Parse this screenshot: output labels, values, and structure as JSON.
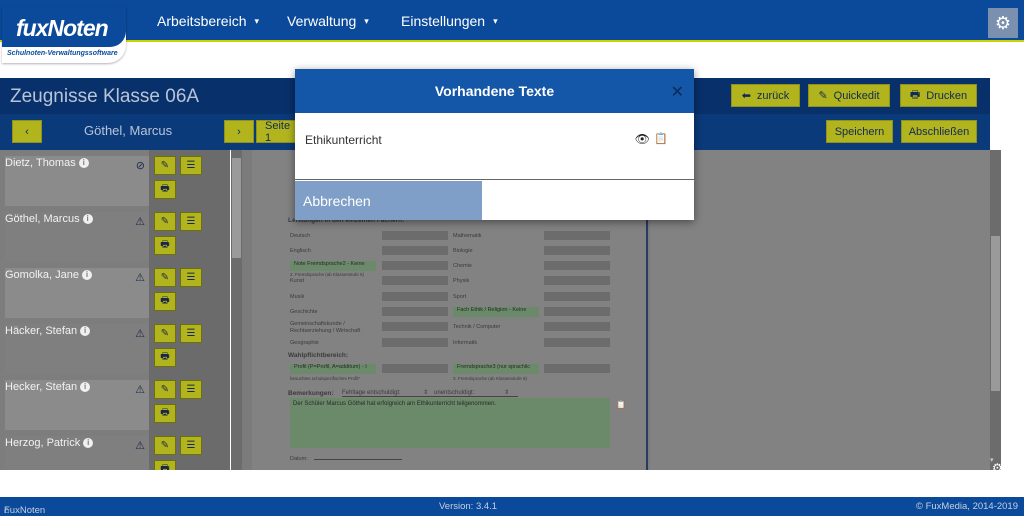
{
  "app": {
    "brand_part1": "fux",
    "brand_part2": "Noten",
    "tagline": "Schulnoten-Verwaltungssoftware"
  },
  "nav": {
    "items": [
      {
        "label": "Arbeitsbereich"
      },
      {
        "label": "Verwaltung"
      },
      {
        "label": "Einstellungen"
      }
    ],
    "caret": "▾",
    "settings_icon": "gear-icon"
  },
  "page": {
    "title": "Zeugnisse Klasse 06A",
    "current_student": "Göthel, Marcus",
    "page_label": "Seite 1",
    "buttons": {
      "back": "zurück",
      "quickedit": "Quickedit",
      "print": "Drucken",
      "save": "Speichern",
      "finish": "Abschließen"
    }
  },
  "students": [
    {
      "name": "Dietz, Thomas",
      "status": "check"
    },
    {
      "name": "Göthel, Marcus",
      "status": "warning"
    },
    {
      "name": "Gomolka, Jane",
      "status": "warning"
    },
    {
      "name": "Häcker, Stefan",
      "status": "warning"
    },
    {
      "name": "Hecker, Stefan",
      "status": "warning"
    },
    {
      "name": "Herzog, Patrick",
      "status": "warning"
    }
  ],
  "document": {
    "section_subjects": "Leistungen in den einzelnen Fächern:",
    "subjects_left": [
      "Deutsch",
      "Englisch",
      "Note Fremdsprache2 - Keine",
      "2. Fremdsprache (ab Klassenstufe 6)",
      "Kunst",
      "Musik",
      "Geschichte",
      "Gemeinschaftskunde / Rechtserziehung / Wirtschaft",
      "Geographie"
    ],
    "subjects_right": [
      "Mathematik",
      "Biologie",
      "Chemie",
      "Physik",
      "Sport",
      "Fach Ethik / Religion - Keine",
      "Technik / Computer",
      "Informatik"
    ],
    "section_elective": "Wahlpflichtbereich:",
    "elective_left": "Profil (P=Profil, A=additum) - I",
    "elective_left_note": "besuchtes schulspezifisches Profil*",
    "elective_right": "Fremdsprache3 (nur sprachlic",
    "elective_right_note": "3. Fremdsprache (ab Klassenstufe 8)",
    "remarks_label": "Bemerkungen:",
    "absence_excused": "Fehltage entschuldigt:",
    "absence_unexcused": "unentschuldigt:",
    "remarks_text": "Der Schüler Marcus Göthel hat erfolgreich am Ethikunterricht teilgenommen.",
    "date_label": "Datum:"
  },
  "modal": {
    "title": "Vorhandene Texte",
    "item": "Ethikunterricht",
    "cancel": "Abbrechen"
  },
  "footer": {
    "left": "FuxNoten",
    "version": "Version: 3.4.1",
    "copyright": "© FuxMedia, 2014-2019"
  },
  "colors": {
    "primary": "#0b4a9a",
    "accent": "#b2b41e",
    "modal_header": "#1456a8"
  }
}
